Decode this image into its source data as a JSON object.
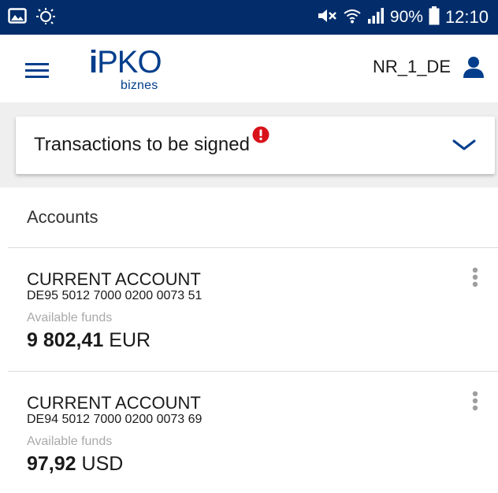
{
  "status_bar": {
    "battery": "90%",
    "time": "12:10",
    "icons": [
      "image-icon",
      "brightness-icon",
      "mute-icon",
      "wifi-icon",
      "signal-icon",
      "battery-icon"
    ]
  },
  "header": {
    "logo": {
      "main": "PKO",
      "i": "i",
      "sub": "biznes"
    },
    "user_name": "NR_1_DE",
    "icons": [
      "menu-icon",
      "user-icon"
    ]
  },
  "transactions": {
    "title": "Transactions to be signed",
    "icons": [
      "alert-icon",
      "chevron-down-icon"
    ]
  },
  "accounts": {
    "heading": "Accounts",
    "items": [
      {
        "type": "CURRENT ACCOUNT",
        "iban": "DE95 5012 7000 0200 0073 51",
        "funds_label": "Available funds",
        "amount": "9 802,41",
        "currency": "EUR"
      },
      {
        "type": "CURRENT ACCOUNT",
        "iban": "DE94 5012 7000 0200 0073 69",
        "funds_label": "Available funds",
        "amount": "97,92",
        "currency": "USD"
      }
    ]
  },
  "colors": {
    "status_bar": "#022d6a",
    "brand_blue": "#033e8c",
    "alert_red": "#d8131c",
    "grey_band": "#efefef",
    "muted_text": "#a9a9a9"
  }
}
